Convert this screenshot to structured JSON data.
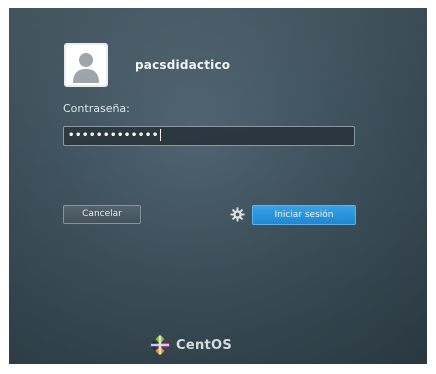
{
  "user": {
    "name": "pacsdidactico"
  },
  "password": {
    "label": "Contraseña:",
    "masked_value": "•••••••••••••"
  },
  "buttons": {
    "cancel_label": "Cancelar",
    "login_label": "Iniciar sesión"
  },
  "footer": {
    "brand": "CentOS"
  },
  "icons": {
    "avatar": "user-avatar-icon",
    "session_options": "gear-icon",
    "logo": "centos-logo-icon"
  },
  "colors": {
    "background": "#3e525d",
    "login_button": "#2b9ae6",
    "text": "#f2f4f5"
  }
}
